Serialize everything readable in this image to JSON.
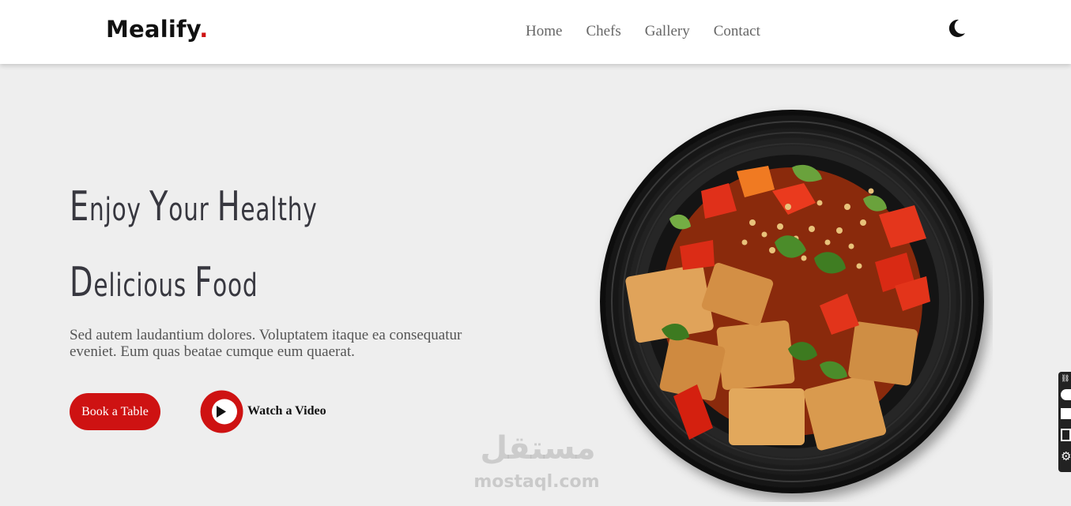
{
  "header": {
    "logo_text": "Mealify",
    "logo_dot": ".",
    "nav": [
      {
        "label": "Home"
      },
      {
        "label": "Chefs"
      },
      {
        "label": "Gallery"
      },
      {
        "label": "Contact"
      }
    ],
    "theme_toggle_icon": "moon-icon"
  },
  "hero": {
    "title_line1": {
      "first": "E",
      "rest": "njoy ",
      "first2": "Y",
      "rest2": "our ",
      "first3": "H",
      "rest3": "ealthy"
    },
    "title_line2": {
      "first": "D",
      "rest": "elicious ",
      "first2": "F",
      "rest2": "ood"
    },
    "description": "Sed autem laudantium dolores. Voluptatem itaque ea consequatur eveniet. Eum quas beatae cumque eum quaerat.",
    "book_button": "Book a Table",
    "video_button": "Watch a Video",
    "video_icon": "play-icon"
  },
  "watermark": {
    "arabic": "مستقل",
    "latin": "mostaql.com"
  },
  "colors": {
    "accent": "#ce1212",
    "background": "#eeeeee",
    "heading": "#37373f",
    "text": "#555555"
  }
}
